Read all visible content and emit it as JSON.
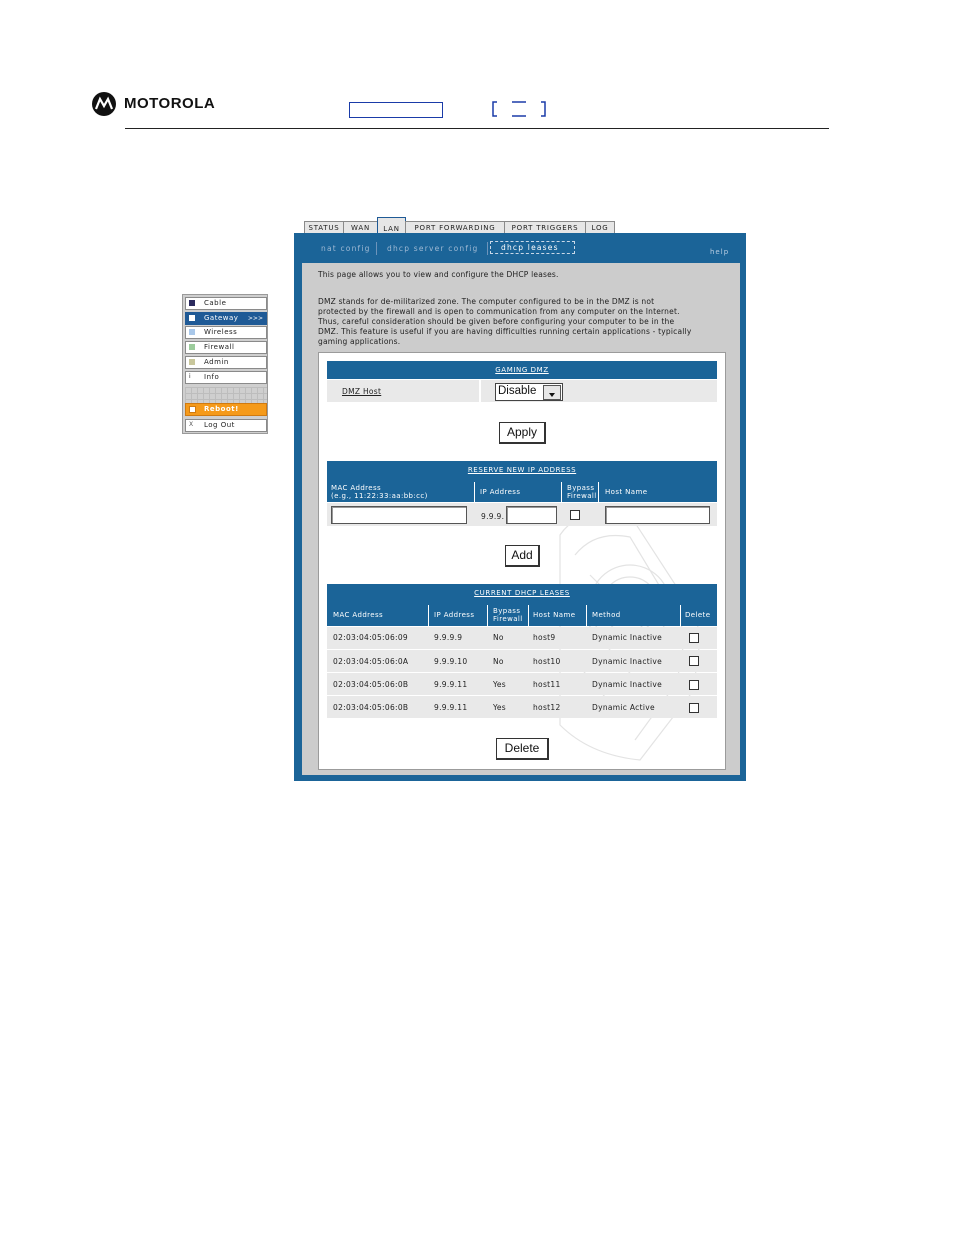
{
  "header": {
    "brand": "MOTOROLA"
  },
  "tabs": [
    {
      "label": "STATUS"
    },
    {
      "label": "WAN"
    },
    {
      "label": "LAN"
    },
    {
      "label": "PORT FORWARDING"
    },
    {
      "label": "PORT TRIGGERS"
    },
    {
      "label": "LOG"
    }
  ],
  "subnav": {
    "items": [
      "nat config",
      "dhcp server config",
      "dhcp leases"
    ],
    "help": "help"
  },
  "side_menu": {
    "items": [
      {
        "label": "Cable",
        "icon": "cable-icon",
        "color": "#2b2a5e"
      },
      {
        "label": "Gateway",
        "icon": "gateway-icon",
        "color": "#ffffff",
        "suffix": ">>>"
      },
      {
        "label": "Wireless",
        "icon": "wireless-icon",
        "color": "#a9c8ea"
      },
      {
        "label": "Firewall",
        "icon": "firewall-icon",
        "color": "#9ccc9c"
      },
      {
        "label": "Admin",
        "icon": "admin-icon",
        "color": "#c9c79c"
      },
      {
        "label": "Info",
        "icon": "info-icon",
        "glyph": "i"
      },
      {
        "label": "Reboot!",
        "icon": "reboot-icon",
        "color": "#f59a1a"
      },
      {
        "label": "Log Out",
        "icon": "logout-icon",
        "glyph": "X"
      }
    ]
  },
  "intro": {
    "line1": "This page allows you to view and configure the DHCP leases.",
    "dmz_lines": [
      "DMZ stands for de-militarized zone. The computer configured to be in the DMZ is not",
      "protected by the firewall and is open to communication from any computer on the Internet.",
      "Thus, careful consideration should be given before configuring your computer to be in the",
      "DMZ. This feature is useful if you are having difficulties running certain applications - typically",
      "gaming applications."
    ]
  },
  "gaming_dmz": {
    "title": "GAMING DMZ",
    "label": "DMZ Host",
    "select_value": "Disable",
    "apply_label": "Apply"
  },
  "reserve": {
    "title": "RESERVE NEW IP ADDRESS",
    "headers": {
      "mac": "MAC Address",
      "mac_hint": "(e.g., 11:22:33:aa:bb:cc)",
      "ip": "IP Address",
      "bypass1": "Bypass",
      "bypass2": "Firewall",
      "host": "Host Name"
    },
    "ip_prefix": "9.9.9.",
    "mac_value": "",
    "ip_value": "",
    "host_value": "",
    "add_label": "Add"
  },
  "leases": {
    "title": "CURRENT DHCP LEASES",
    "headers": {
      "mac": "MAC Address",
      "ip": "IP Address",
      "bypass1": "Bypass",
      "bypass2": "Firewall",
      "host": "Host Name",
      "method": "Method",
      "delete": "Delete"
    },
    "rows": [
      {
        "mac": "02:03:04:05:06:09",
        "ip": "9.9.9.9",
        "bypass": "No",
        "host": "host9",
        "method": "Dynamic Inactive"
      },
      {
        "mac": "02:03:04:05:06:0A",
        "ip": "9.9.9.10",
        "bypass": "No",
        "host": "host10",
        "method": "Dynamic Inactive"
      },
      {
        "mac": "02:03:04:05:06:0B",
        "ip": "9.9.9.11",
        "bypass": "Yes",
        "host": "host11",
        "method": "Dynamic Inactive"
      },
      {
        "mac": "02:03:04:05:06:0B",
        "ip": "9.9.9.11",
        "bypass": "Yes",
        "host": "host12",
        "method": "Dynamic Active"
      }
    ],
    "delete_label": "Delete"
  },
  "colors": {
    "accent": "#1b6498",
    "panel_bg": "#cccccc",
    "reboot": "#f59a1a"
  }
}
